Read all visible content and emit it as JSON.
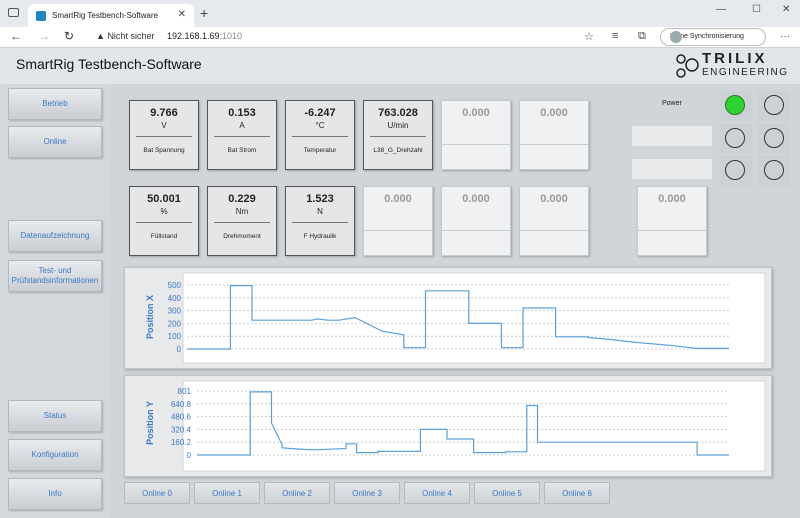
{
  "browser": {
    "tab_title": "SmartRig Testbench-Software",
    "tab_close": "✕",
    "new_tab": "+",
    "url_warning": "Nicht sicher",
    "url_host": "192.168.1.69",
    "url_port": ":1010",
    "sync_label": "Keine Synchronisierung",
    "minimize": "—",
    "maximize": "☐",
    "close": "✕"
  },
  "app": {
    "title": "SmartRig Testbench-Software",
    "logo_word1": "TRILIX",
    "logo_word2": "ENGINEERING"
  },
  "sidebar": {
    "items": [
      "Betrieb",
      "Online",
      "Datenaufzeichnung",
      "Test- und Prüfstandsinformationen",
      "Status",
      "Konfiguration",
      "Info"
    ]
  },
  "tiles_row1": [
    {
      "value": "9.766",
      "unit": "V",
      "label": "Bat Spannung"
    },
    {
      "value": "0.153",
      "unit": "A",
      "label": "Bat Strom"
    },
    {
      "value": "-6.247",
      "unit": "°C",
      "label": "Temperatur"
    },
    {
      "value": "763.028",
      "unit": "U/min",
      "label": "L38_G_Drehzahl"
    },
    {
      "value": "0.000",
      "unit": "",
      "label": ""
    },
    {
      "value": "0.000",
      "unit": "",
      "label": ""
    }
  ],
  "tiles_row2": [
    {
      "value": "50.001",
      "unit": "%",
      "label": "Füllstand"
    },
    {
      "value": "0.229",
      "unit": "Nm",
      "label": "Drehmoment"
    },
    {
      "value": "1.523",
      "unit": "N",
      "label": "F Hydraulik"
    },
    {
      "value": "0.000",
      "unit": "",
      "label": ""
    },
    {
      "value": "0.000",
      "unit": "",
      "label": ""
    },
    {
      "value": "0.000",
      "unit": "",
      "label": ""
    }
  ],
  "extra_tile": {
    "value": "0.000"
  },
  "power": {
    "label": "Power",
    "on_color": "#2fd32f"
  },
  "online_buttons": [
    "Online 0",
    "Online 1",
    "Online 2",
    "Online 3",
    "Online 4",
    "Online 5",
    "Online 6"
  ],
  "chart_data": [
    {
      "type": "line",
      "ylabel": "Position X",
      "yticks": [
        "500",
        "400",
        "300",
        "200",
        "100",
        "0"
      ],
      "ylim": [
        0,
        500
      ],
      "xlim": [
        0,
        100
      ],
      "line_color": "#5aa0dc",
      "x": [
        0,
        8,
        8,
        12,
        12,
        23,
        24,
        26,
        28,
        31,
        31,
        36,
        36,
        40,
        40,
        44,
        44,
        52,
        52,
        58,
        58,
        62,
        62,
        68,
        68,
        74,
        74,
        78,
        82,
        86,
        90,
        94,
        100
      ],
      "y": [
        0,
        0,
        495,
        495,
        225,
        225,
        235,
        225,
        225,
        245,
        245,
        140,
        140,
        110,
        10,
        10,
        455,
        455,
        200,
        200,
        10,
        10,
        320,
        320,
        95,
        95,
        90,
        75,
        55,
        40,
        25,
        5,
        5
      ]
    },
    {
      "type": "line",
      "ylabel": "Position Y",
      "yticks": [
        "801",
        "640.8",
        "480.6",
        "320.4",
        "160.2",
        "0"
      ],
      "ylim": [
        0,
        801
      ],
      "xlim": [
        0,
        100
      ],
      "line_color": "#5aa0dc",
      "x": [
        0,
        10,
        10,
        14,
        14,
        16,
        16,
        18,
        20,
        22,
        28,
        28,
        30,
        30,
        34,
        34,
        42,
        42,
        47,
        47,
        52,
        52,
        58,
        58,
        62,
        62,
        64,
        64,
        94,
        94,
        100
      ],
      "y": [
        0,
        0,
        790,
        790,
        400,
        130,
        90,
        80,
        70,
        65,
        80,
        140,
        140,
        30,
        30,
        45,
        45,
        320,
        320,
        200,
        200,
        30,
        30,
        40,
        40,
        620,
        620,
        160,
        160,
        0,
        0
      ]
    }
  ]
}
